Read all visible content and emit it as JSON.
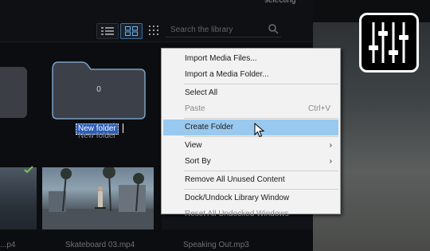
{
  "library": {
    "title_fragment": "selecting",
    "search_placeholder": "Search the library",
    "folder": {
      "item_count": "0",
      "rename_value": "New folder",
      "label": "New folder"
    },
    "thumb_captions": [
      "...p4",
      "Skateboard 03.mp4",
      "Speaking Out.mp3"
    ]
  },
  "context_menu": {
    "items": [
      {
        "label": "Import Media Files...",
        "enabled": true
      },
      {
        "label": "Import a Media Folder...",
        "enabled": true
      },
      {
        "label": "Select All",
        "enabled": true
      },
      {
        "label": "Paste",
        "enabled": false,
        "shortcut": "Ctrl+V"
      },
      {
        "label": "Create Folder",
        "enabled": true,
        "highlighted": true
      },
      {
        "label": "View",
        "enabled": true,
        "submenu": true
      },
      {
        "label": "Sort By",
        "enabled": true,
        "submenu": true
      },
      {
        "label": "Remove All Unused Content",
        "enabled": true
      },
      {
        "label": "Dock/Undock Library Window",
        "enabled": true
      },
      {
        "label": "Reset All Undocked Windows",
        "enabled": false
      }
    ],
    "submenu_arrow": "›"
  },
  "colors": {
    "menu_highlight": "#99c9ef",
    "rename_selection": "#2a5bb6",
    "folder_outline": "#7da0c4",
    "active_view": "#3e6f98"
  },
  "icons": [
    "list-view-icon",
    "grid-view-icon",
    "dots-grid-icon",
    "search-icon",
    "mixer-sliders-icon",
    "checkmark-icon",
    "mouse-cursor-icon"
  ]
}
